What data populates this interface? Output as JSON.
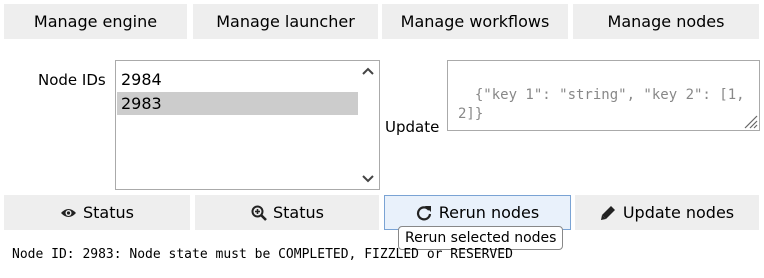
{
  "tabs": [
    {
      "label": "Manage engine"
    },
    {
      "label": "Manage launcher"
    },
    {
      "label": "Manage workflows"
    },
    {
      "label": "Manage nodes"
    }
  ],
  "node_ids": {
    "label": "Node IDs",
    "items": [
      "2984",
      "2983"
    ],
    "selected": "2983"
  },
  "update": {
    "label": "Update",
    "placeholder": "{\"key 1\": \"string\", \"key 2\": [1, 2]}"
  },
  "buttons": {
    "status_label": "Status",
    "status_detail_label": "Status",
    "rerun_label": "Rerun nodes",
    "update_nodes_label": "Update nodes"
  },
  "tooltip": "Rerun selected nodes",
  "status_message": "Node ID: 2983: Node state must be COMPLETED, FIZZLED or RESERVED",
  "icons": {
    "status": "eye-icon",
    "status_detail": "zoom-in-icon",
    "rerun": "redo-icon",
    "update_nodes": "pencil-icon"
  },
  "colors": {
    "button_bg": "#eeeeee",
    "selected_row": "#cccccc",
    "active_border": "#7aa3d4"
  }
}
